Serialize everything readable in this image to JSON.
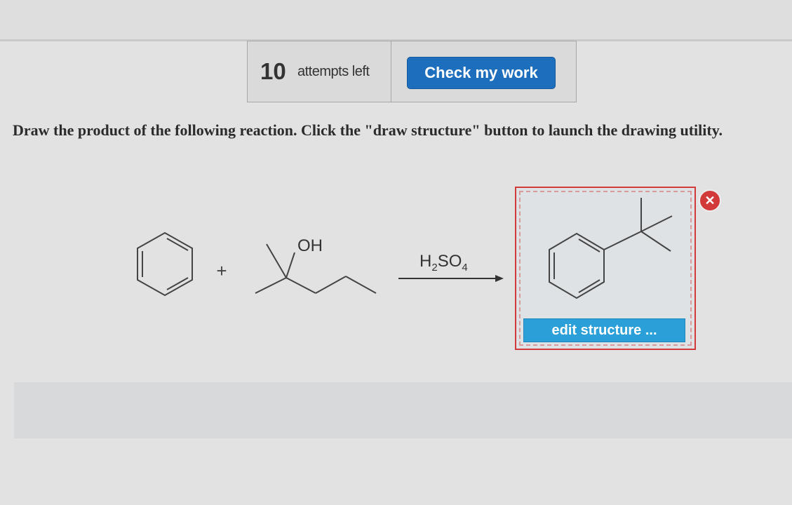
{
  "attempts": {
    "count": "10",
    "label": "attempts left"
  },
  "actions": {
    "check_label": "Check my work",
    "edit_label": "edit structure ...",
    "remove_glyph": "✕"
  },
  "question": {
    "prompt": "Draw the product of the following reaction. Click the \"draw structure\" button to launch the drawing utility."
  },
  "reaction": {
    "plus": "+",
    "reagent_label": "OH",
    "catalyst": {
      "main": "H",
      "sub1": "2",
      "mid": "SO",
      "sub2": "4"
    }
  },
  "colors": {
    "accent_blue": "#1d6fbe",
    "edit_blue": "#2ba0d8",
    "answer_border": "#d23a3a"
  }
}
